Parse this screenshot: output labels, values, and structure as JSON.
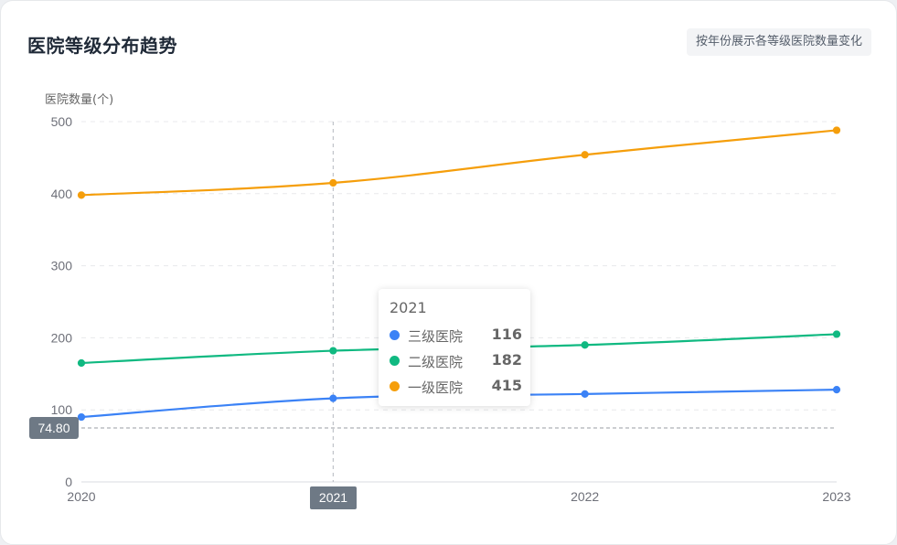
{
  "header": {
    "title": "医院等级分布趋势",
    "badge": "按年份展示各等级医院数量变化"
  },
  "chart_data": {
    "type": "line",
    "x": [
      "2020",
      "2021",
      "2022",
      "2023"
    ],
    "ylabel": "医院数量(个)",
    "ylim": [
      0,
      500
    ],
    "yticks": [
      0,
      100,
      200,
      300,
      400,
      500
    ],
    "grid": true,
    "smooth": true,
    "series": [
      {
        "name": "三级医院",
        "color": "#3b82f6",
        "values": [
          90,
          116,
          122,
          128
        ]
      },
      {
        "name": "二级医院",
        "color": "#10b981",
        "values": [
          165,
          182,
          190,
          205
        ]
      },
      {
        "name": "一级医院",
        "color": "#f59e0b",
        "values": [
          398,
          415,
          454,
          488
        ]
      }
    ]
  },
  "tooltip": {
    "title": "2021",
    "rows": [
      {
        "name": "三级医院",
        "value": "116",
        "color": "#3b82f6"
      },
      {
        "name": "二级医院",
        "value": "182",
        "color": "#10b981"
      },
      {
        "name": "一级医院",
        "value": "415",
        "color": "#f59e0b"
      }
    ]
  },
  "axis_pointer": {
    "x_label": "2021",
    "y_label": "74.80",
    "y_value": 74.8
  }
}
